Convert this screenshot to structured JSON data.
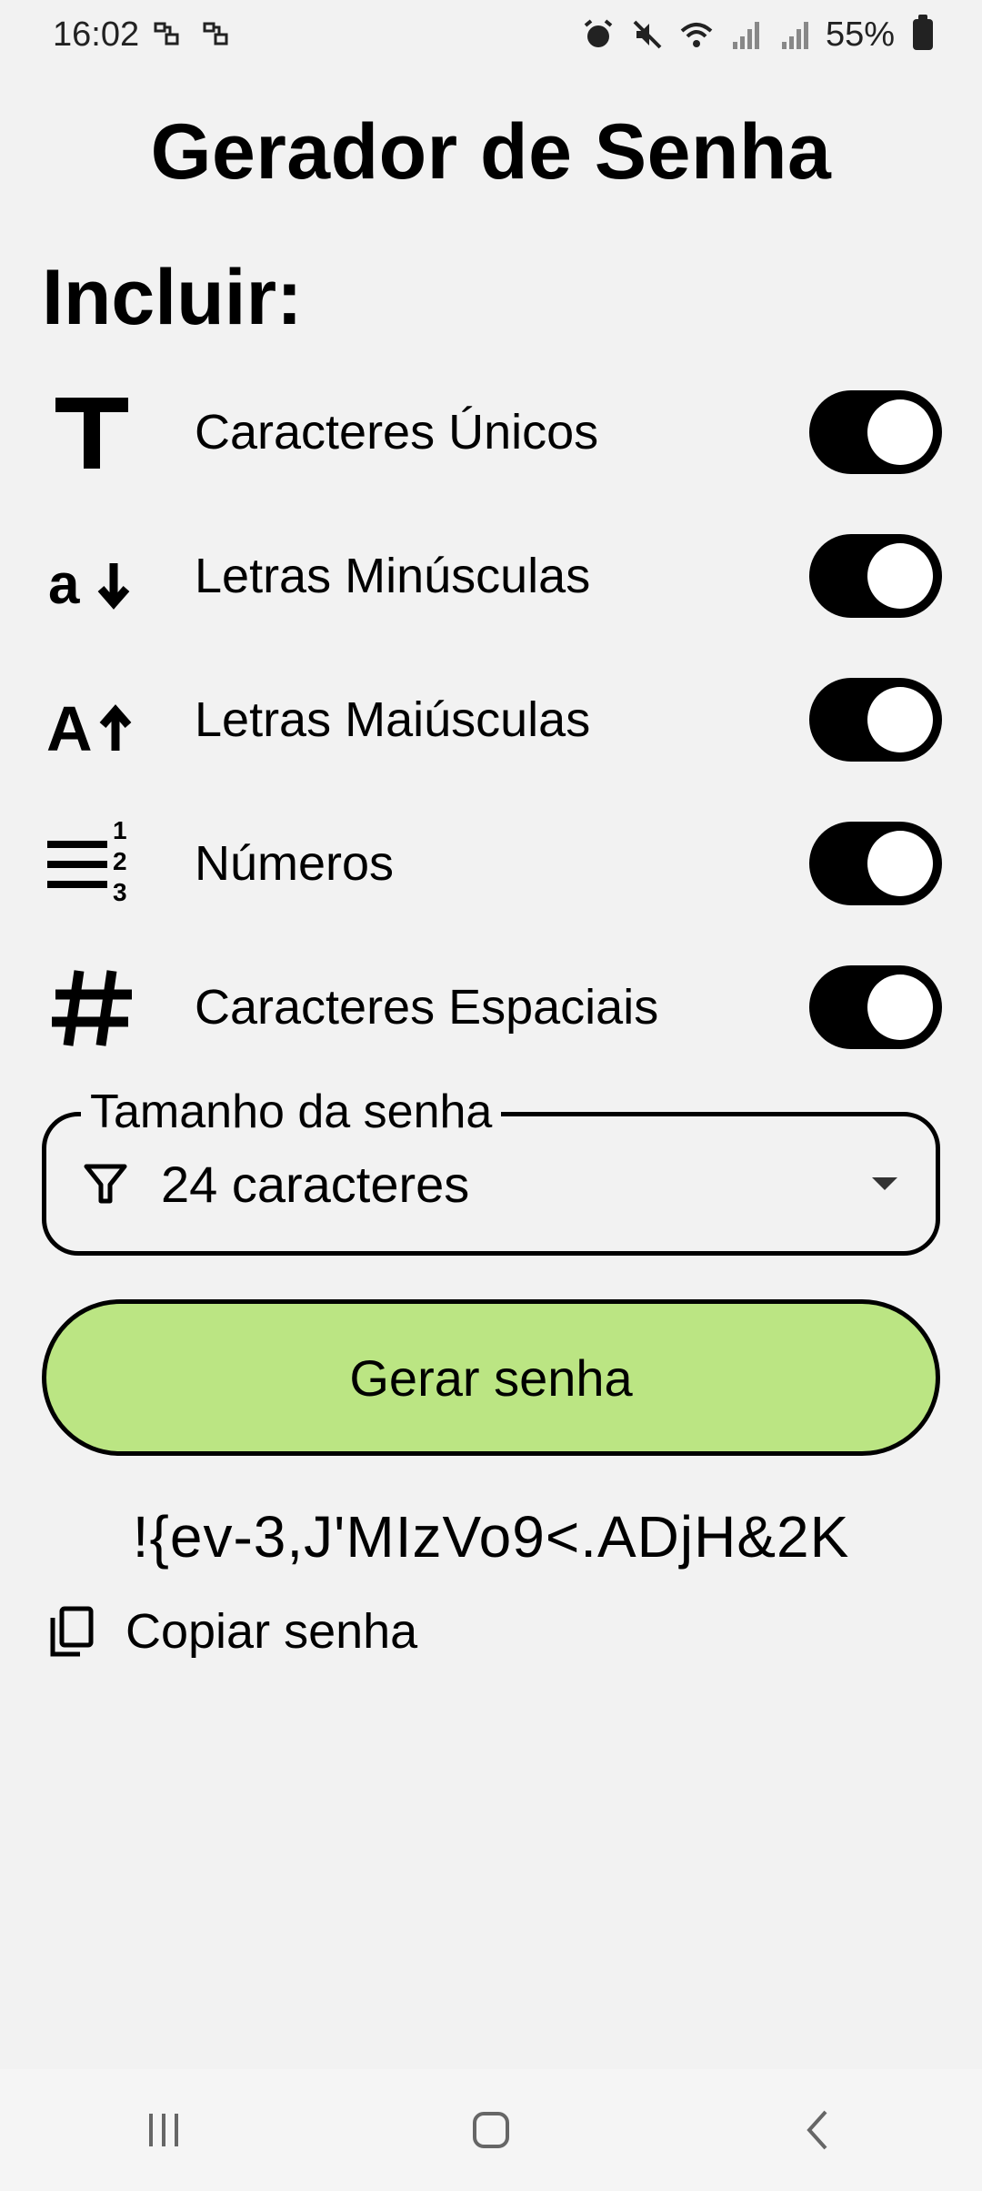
{
  "status_bar": {
    "time": "16:02",
    "battery": "55%"
  },
  "app": {
    "title": "Gerador de Senha",
    "include_heading": "Incluir:"
  },
  "options": [
    {
      "label": "Caracteres Únicos",
      "icon": "text-t-icon",
      "enabled": true
    },
    {
      "label": "Letras Minúsculas",
      "icon": "lowercase-arrow-down-icon",
      "enabled": true
    },
    {
      "label": "Letras Maiúsculas",
      "icon": "uppercase-arrow-up-icon",
      "enabled": true
    },
    {
      "label": "Números",
      "icon": "format-list-numbered-icon",
      "enabled": true
    },
    {
      "label": "Caracteres Espaciais",
      "icon": "hashtag-icon",
      "enabled": true
    }
  ],
  "length_field": {
    "label": "Tamanho da senha",
    "value": "24 caracteres",
    "icon": "filter-icon"
  },
  "generate_button": {
    "label": "Gerar senha",
    "color": "#bbe583"
  },
  "generated_password": "!{ev-3,J'MIzVo9<.ADjH&2K",
  "copy": {
    "label": "Copiar senha",
    "icon": "copy-icon"
  }
}
